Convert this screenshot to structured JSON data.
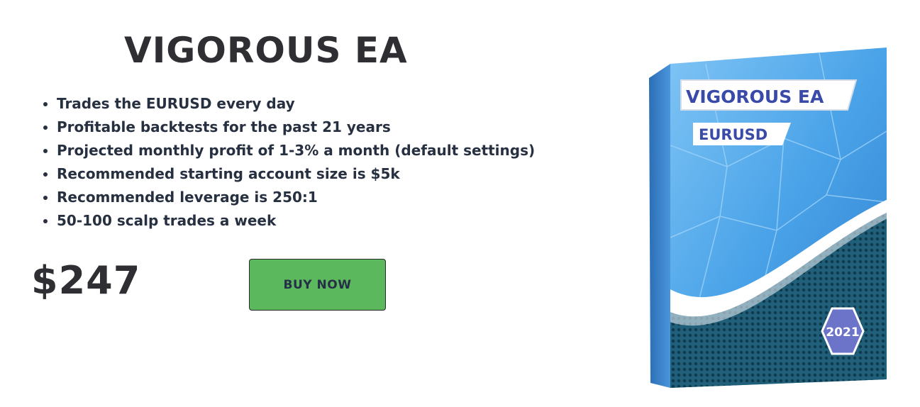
{
  "product": {
    "title": "VIGOROUS EA",
    "features": [
      "Trades the EURUSD every day",
      "Profitable backtests for the past 21 years",
      "Projected monthly profit of 1-3% a month (default settings)",
      "Recommended starting account size is $5k",
      "Recommended leverage is 250:1",
      "50-100 scalp trades a week"
    ],
    "price": "$247",
    "buy_label": "BUY NOW"
  },
  "box": {
    "title": "VIGOROUS EA",
    "pair": "EURUSD",
    "year": "2021"
  },
  "colors": {
    "button_green": "#5cb85c",
    "heading_text": "#2e2e33",
    "box_blue": "#4aa3e8",
    "box_dark_teal": "#1f5f7a",
    "badge_purple": "#6b74c8"
  }
}
